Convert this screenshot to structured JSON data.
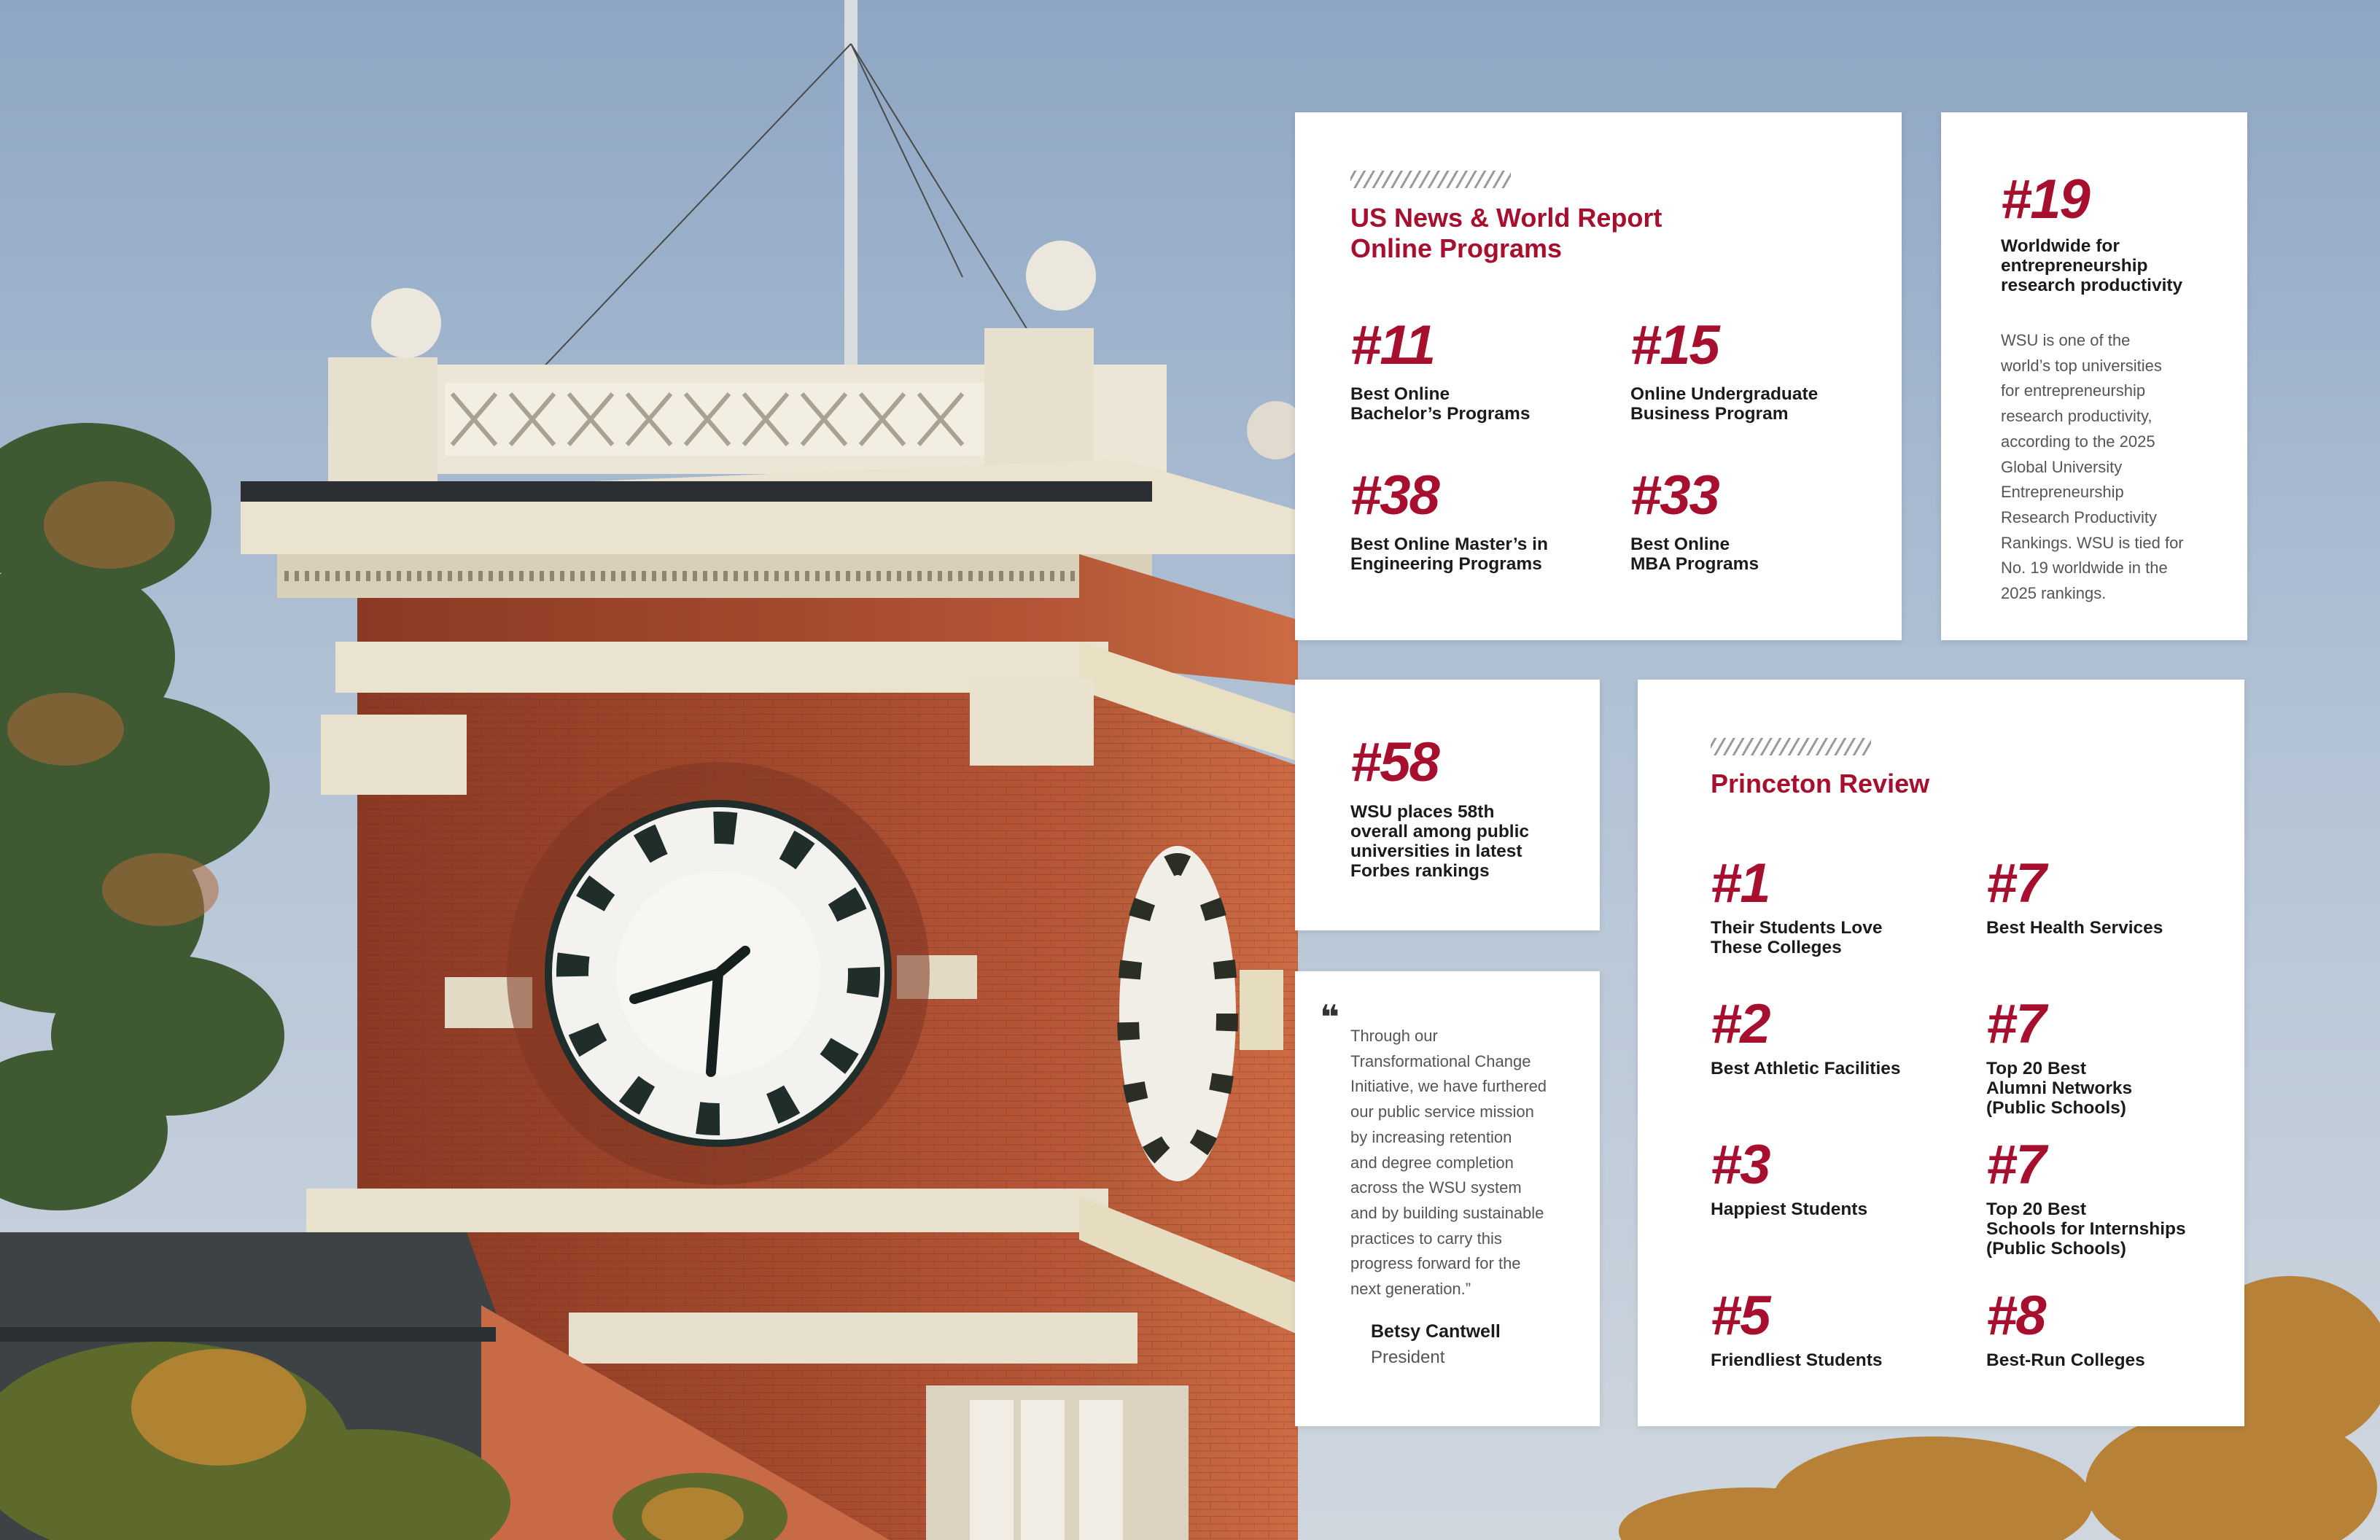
{
  "colors": {
    "accent": "#a60f2d",
    "card_bg": "#ffffff",
    "text_dark": "#1b1b1b",
    "text_body": "#555555"
  },
  "usnews": {
    "heading": "US News & World Report\nOnline Programs",
    "items": [
      {
        "rank": "#11",
        "label": "Best Online\nBachelor’s Programs"
      },
      {
        "rank": "#15",
        "label": "Online Undergraduate\nBusiness Program"
      },
      {
        "rank": "#38",
        "label": "Best Online Master’s in\nEngineering Programs"
      },
      {
        "rank": "#33",
        "label": "Best Online\nMBA Programs"
      }
    ]
  },
  "entrepreneurship": {
    "rank": "#19",
    "label": "Worldwide for\nentrepreneurship\nresearch productivity",
    "body": "WSU is one of the\nworld’s top universities\nfor entrepreneurship\nresearch productivity,\naccording to the 2025\nGlobal University\nEntrepreneurship\nResearch Productivity\nRankings. WSU is tied for\nNo. 19 worldwide in the\n2025 rankings."
  },
  "forbes": {
    "rank": "#58",
    "label": "WSU places 58th\noverall among public\nuniversities in latest\nForbes rankings"
  },
  "quote": {
    "text": "Through our\nTransformational Change\nInitiative, we have furthered\nour public service mission\nby increasing retention\nand degree completion\nacross the WSU system\nand by building sustainable\npractices to carry this\nprogress forward for the\nnext generation.”",
    "name": "Betsy Cantwell",
    "title": "President"
  },
  "princeton": {
    "heading": "Princeton Review",
    "items": [
      {
        "rank": "#1",
        "label": "Their Students Love\nThese Colleges"
      },
      {
        "rank": "#7",
        "label": "Best Health Services"
      },
      {
        "rank": "#2",
        "label": "Best Athletic Facilities"
      },
      {
        "rank": "#7",
        "label": "Top 20 Best\nAlumni Networks\n(Public Schools)"
      },
      {
        "rank": "#3",
        "label": "Happiest Students"
      },
      {
        "rank": "#7",
        "label": "Top 20 Best\nSchools for Internships\n(Public Schools)"
      },
      {
        "rank": "#5",
        "label": "Friendliest Students"
      },
      {
        "rank": "#8",
        "label": "Best-Run Colleges"
      }
    ]
  },
  "background": {
    "subject": "brick clock tower with Roman numeral clock faces against a blue sky with trees"
  }
}
